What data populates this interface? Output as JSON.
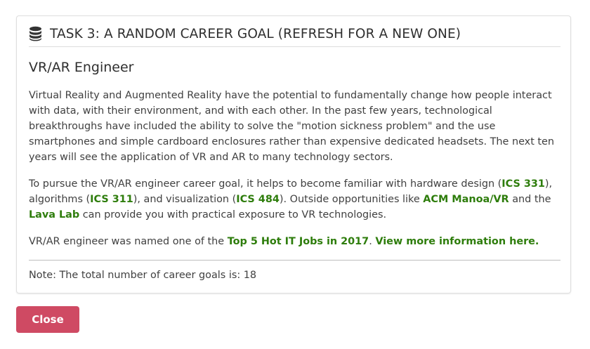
{
  "task": {
    "header_icon": "database-icon",
    "title": "TASK 3: A RANDOM CAREER GOAL (REFRESH FOR A NEW ONE)"
  },
  "goal": {
    "title": "VR/AR Engineer",
    "description": "Virtual Reality and Augmented Reality have the potential to fundamentally change how people interact with data, with their environment, and with each other. In the past few years, technological breakthroughs have included the ability to solve the \"motion sickness problem\" and the use smartphones and simple cardboard enclosures rather than expensive dedicated headsets. The next ten years will see the application of VR and AR to many technology sectors.",
    "pursue": {
      "t1": "To pursue the VR/AR engineer career goal, it helps to become familiar with hardware design (",
      "link_ics331": "ICS 331",
      "t2": "), algorithms (",
      "link_ics311": "ICS 311",
      "t3": "), and visualization (",
      "link_ics484": "ICS 484",
      "t4": "). Outside opportunities like ",
      "link_acm": "ACM Manoa/VR",
      "t5": " and the ",
      "link_lava": "Lava Lab",
      "t6": " can provide you with practical exposure to VR technologies."
    },
    "hot": {
      "t1": "VR/AR engineer was named one of the ",
      "link_top5": "Top 5 Hot IT Jobs in 2017",
      "t2": ". ",
      "link_more": "View more information here."
    }
  },
  "note": "Note: The total number of career goals is: 18",
  "close_button": "Close",
  "colors": {
    "link": "#2e7d0c",
    "close_button_bg": "#cf4a63"
  }
}
